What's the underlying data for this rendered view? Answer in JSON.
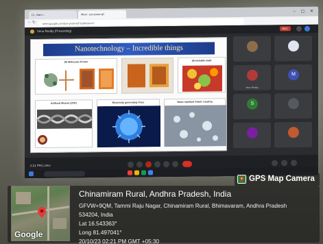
{
  "browser": {
    "tabs": [
      "Cl...Nan t...",
      "Meet - jun-yxaw-tyt"
    ],
    "url": "meet.google.com/jun-yxaw-tyt?authuser=0"
  },
  "meeting": {
    "presenter": "Venu Reddy (Presenting)",
    "rec_label": "REC",
    "time_code": "2:21 PM  |  zmo-  ",
    "participants": [
      {
        "initial": "",
        "name": "",
        "color": "#8e6d4b"
      },
      {
        "initial": "",
        "name": "",
        "color": "#e0e6f0"
      },
      {
        "initial": "",
        "name": "Venu Reddy",
        "color": "#b23a3a"
      },
      {
        "initial": "M",
        "name": "",
        "color": "#3f51b5"
      },
      {
        "initial": "S",
        "name": "",
        "color": "#2e7d32"
      },
      {
        "initial": "",
        "name": "",
        "color": "#555960"
      },
      {
        "initial": "",
        "name": "",
        "color": "#7b1fa2"
      },
      {
        "initial": "",
        "name": "",
        "color": "#bf5b2f"
      }
    ]
  },
  "slide": {
    "title": "Nanotechnology – Incredible things",
    "panels": [
      {
        "caption": "3D Molecular Printer"
      },
      {
        "caption": "Stretchable Gold"
      },
      {
        "caption": "Artificial Muscle (CNT)"
      },
      {
        "caption": "Electricity generating Virus"
      },
      {
        "caption": "Nano-repellant Fabric Coating"
      }
    ]
  },
  "gps": {
    "brand": "GPS Map Camera",
    "title": "Chinamiram Rural, Andhra Pradesh, India",
    "address_line1": "GFVW+9QM, Tammi Raju Nagar, Chinamiram Rural, Bhimavaram, Andhra Pradesh",
    "address_line2": "534204, India",
    "lat": "Lat 16.543363°",
    "long": "Long 81.497041°",
    "datetime": "20/10/23 02:21 PM GMT +05:30",
    "map_brand": "Google"
  }
}
